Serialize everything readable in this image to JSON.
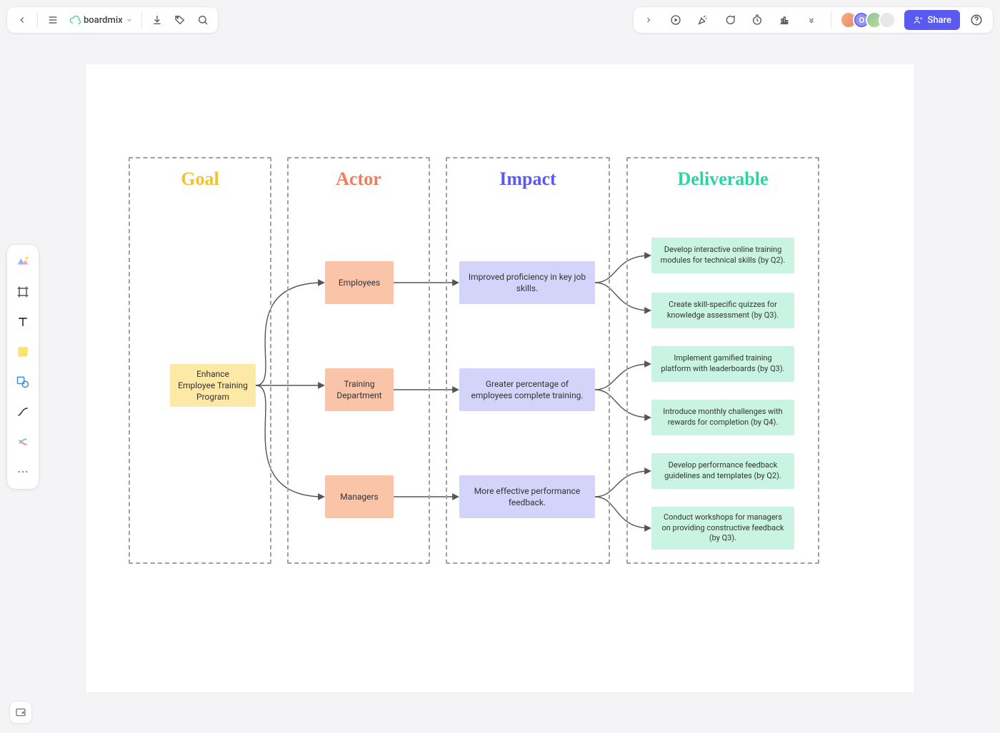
{
  "header": {
    "app_name": "boardmix",
    "share_label": "Share",
    "avatars": [
      {
        "id": "a1",
        "initial": ""
      },
      {
        "id": "a2",
        "initial": "O"
      },
      {
        "id": "a3",
        "initial": ""
      },
      {
        "id": "a4",
        "initial": ""
      }
    ]
  },
  "columns": {
    "goal": {
      "title": "Goal",
      "color": "#f2c230"
    },
    "actor": {
      "title": "Actor",
      "color": "#f57c5b"
    },
    "impact": {
      "title": "Impact",
      "color": "#5a5af0"
    },
    "deliverable": {
      "title": "Deliverable",
      "color": "#2dd4a3"
    }
  },
  "impact_map": {
    "goal": "Enhance Employee Training Program",
    "actors": [
      {
        "name": "Employees",
        "impact": "Improved proficiency in key job skills.",
        "deliverables": [
          "Develop interactive online training modules for technical skills (by Q2).",
          "Create skill-specific quizzes for knowledge assessment (by Q3)."
        ]
      },
      {
        "name": "Training Department",
        "impact": "Greater percentage of employees complete training.",
        "deliverables": [
          "Implement gamified training platform with leaderboards (by Q3).",
          "Introduce monthly challenges with rewards for completion (by Q4)."
        ]
      },
      {
        "name": "Managers",
        "impact": "More effective performance feedback.",
        "deliverables": [
          "Develop performance feedback guidelines and templates (by Q2).",
          "Conduct workshops for managers on providing constructive feedback (by Q3)."
        ]
      }
    ]
  }
}
